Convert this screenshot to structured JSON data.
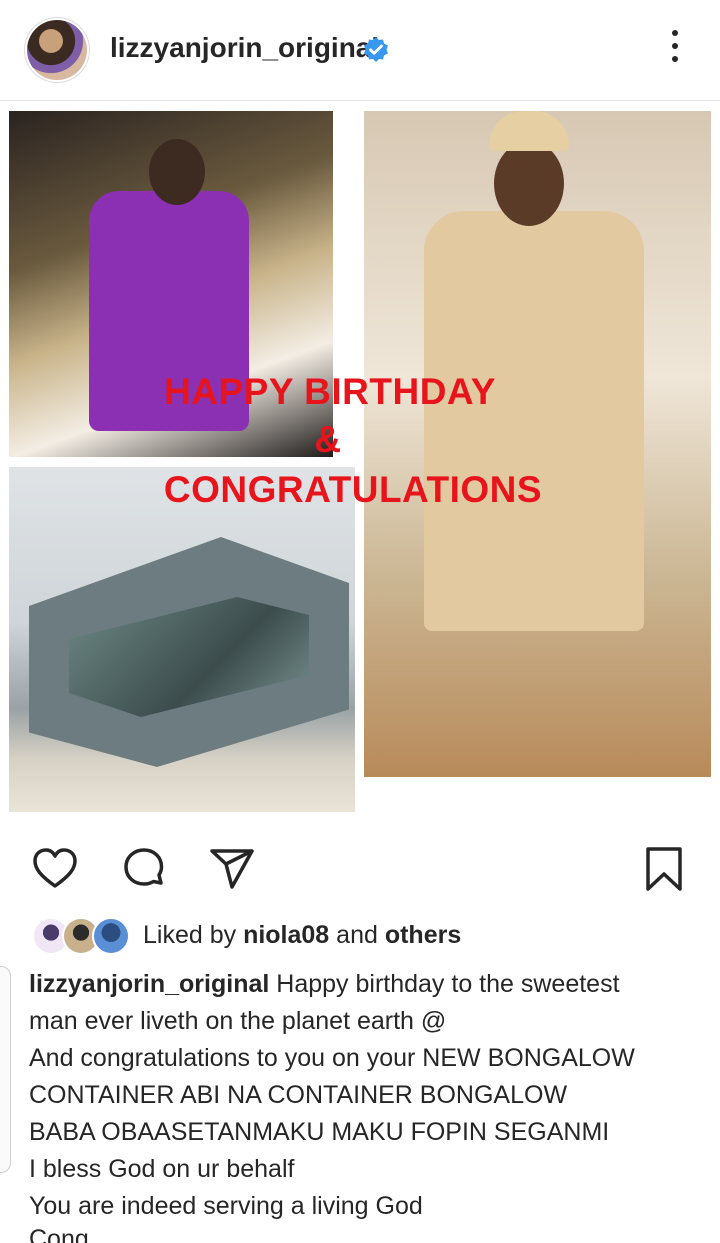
{
  "header": {
    "username": "lizzyanjorin_original",
    "verified_icon": "verified-badge-icon",
    "more_icon": "more-options-icon",
    "badge_color": "#3897f0"
  },
  "post": {
    "overlay_line1": "HAPPY BIRTHDAY",
    "overlay_line2": "&",
    "overlay_line3": "CONGRATULATIONS",
    "overlay_color": "#e8141c"
  },
  "actions": {
    "like_icon": "heart-icon",
    "comment_icon": "comment-icon",
    "share_icon": "send-icon",
    "save_icon": "bookmark-icon"
  },
  "likes": {
    "prefix": "Liked by ",
    "user": "niola08",
    "middle": " and ",
    "others": "others"
  },
  "caption": {
    "username": "lizzyanjorin_original",
    "lines": [
      "Happy birthday to the sweetest",
      "man ever liveth on the planet earth @",
      "And congratulations to you on your NEW BONGALOW",
      "CONTAINER  ABI NA CONTAINER BONGALOW",
      "BABA OBAASETANMAKU MAKU FOPIN SEGANMI",
      "I bless God on ur behalf",
      "You are indeed serving a living God",
      "Cong..."
    ]
  }
}
